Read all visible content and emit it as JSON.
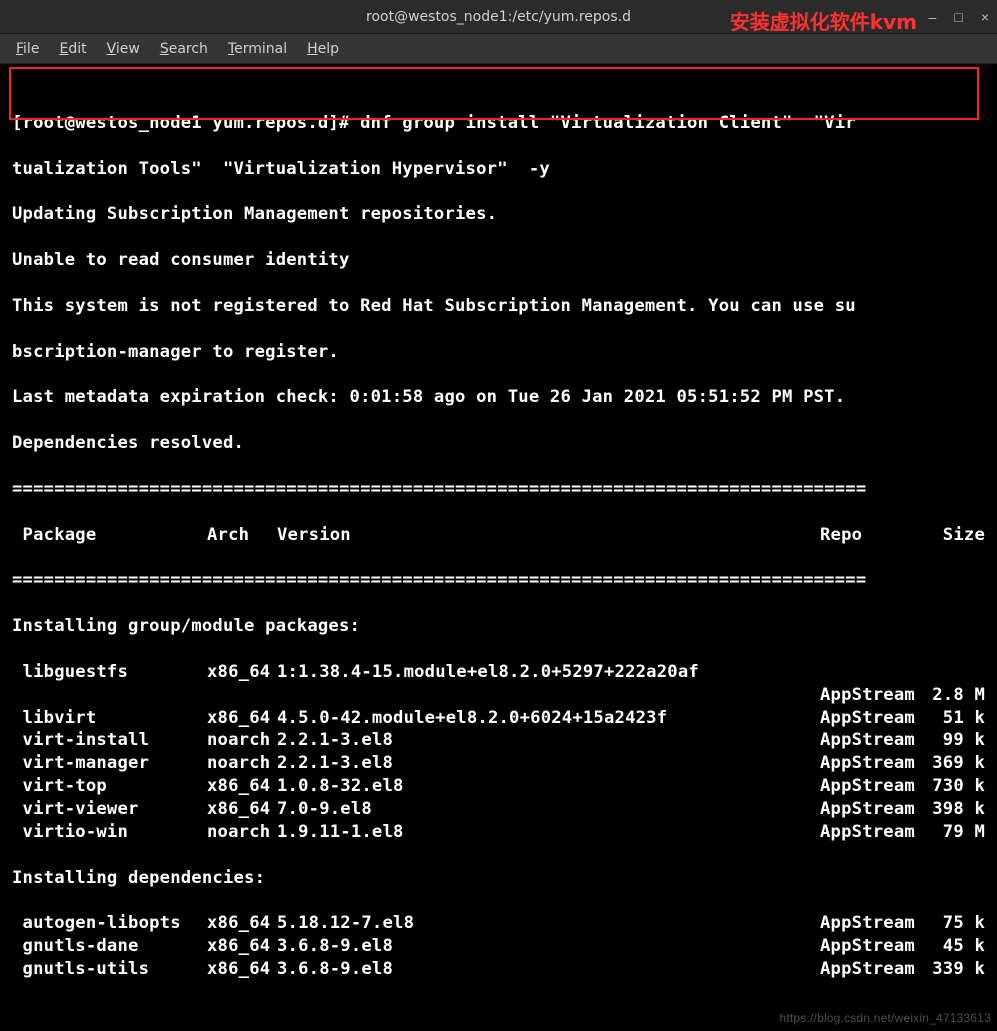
{
  "window": {
    "title": "root@westos_node1:/etc/yum.repos.d",
    "overlay": "安装虚拟化软件kvm",
    "minimize": "–",
    "maximize": "□",
    "close": "×"
  },
  "menu": {
    "file": "File",
    "edit": "Edit",
    "view": "View",
    "search": "Search",
    "terminal": "Terminal",
    "help": "Help"
  },
  "prompt_line1": "[root@westos_node1 yum.repos.d]# dnf group install \"Virtualization Client\"  \"Vir",
  "prompt_line2": "tualization Tools\"  \"Virtualization Hypervisor\"  -y",
  "output_lines": [
    "Updating Subscription Management repositories.",
    "Unable to read consumer identity",
    "This system is not registered to Red Hat Subscription Management. You can use su",
    "bscription-manager to register.",
    "Last metadata expiration check: 0:01:58 ago on Tue 26 Jan 2021 05:51:52 PM PST.",
    "Dependencies resolved."
  ],
  "divider": "=================================================================================",
  "header": {
    "package": " Package",
    "arch": "Arch",
    "version": "Version",
    "repo": "Repo",
    "size": "Size"
  },
  "section1": "Installing group/module packages:",
  "section2": "Installing dependencies:",
  "packages_group": [
    {
      "name": " libguestfs",
      "arch": "x86_64",
      "ver": "1:1.38.4-15.module+el8.2.0+5297+222a20af",
      "repo": "",
      "size": ""
    },
    {
      "name": "",
      "arch": "",
      "ver": "",
      "repo": "AppStream",
      "size": "2.8 M"
    },
    {
      "name": " libvirt",
      "arch": "x86_64",
      "ver": "4.5.0-42.module+el8.2.0+6024+15a2423f",
      "repo": "AppStream",
      "size": " 51 k"
    },
    {
      "name": " virt-install",
      "arch": "noarch",
      "ver": "2.2.1-3.el8",
      "repo": "AppStream",
      "size": " 99 k"
    },
    {
      "name": " virt-manager",
      "arch": "noarch",
      "ver": "2.2.1-3.el8",
      "repo": "AppStream",
      "size": "369 k"
    },
    {
      "name": " virt-top",
      "arch": "x86_64",
      "ver": "1.0.8-32.el8",
      "repo": "AppStream",
      "size": "730 k"
    },
    {
      "name": " virt-viewer",
      "arch": "x86_64",
      "ver": "7.0-9.el8",
      "repo": "AppStream",
      "size": "398 k"
    },
    {
      "name": " virtio-win",
      "arch": "noarch",
      "ver": "1.9.11-1.el8",
      "repo": "AppStream",
      "size": " 79 M"
    }
  ],
  "packages_deps": [
    {
      "name": " autogen-libopts",
      "arch": "x86_64",
      "ver": "5.18.12-7.el8",
      "repo": "AppStream",
      "size": " 75 k"
    },
    {
      "name": " gnutls-dane",
      "arch": "x86_64",
      "ver": "3.6.8-9.el8",
      "repo": "AppStream",
      "size": " 45 k"
    },
    {
      "name": " gnutls-utils",
      "arch": "x86_64",
      "ver": "3.6.8-9.el8",
      "repo": "AppStream",
      "size": "339 k"
    }
  ],
  "watermark": "https://blog.csdn.net/weixin_47133613"
}
